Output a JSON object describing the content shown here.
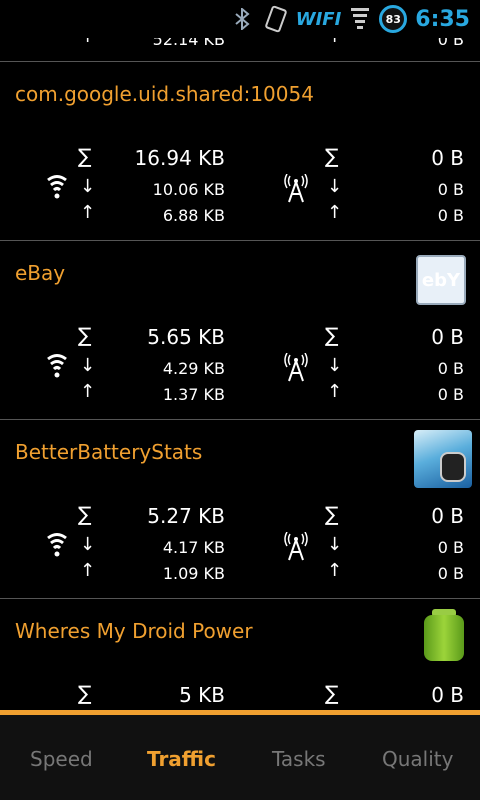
{
  "status_bar": {
    "time": "6:35",
    "battery_level": "83",
    "wifi_label": "WIFI"
  },
  "partial_top": {
    "total": "52.14 KB",
    "mobile_total": "0 B"
  },
  "apps": [
    {
      "name": "com.google.uid.shared:10054",
      "wifi_total": "16.94 KB",
      "wifi_down": "10.06 KB",
      "wifi_up": "6.88 KB",
      "mobile_total": "0 B",
      "mobile_down": "0 B",
      "mobile_up": "0 B",
      "icon": "none"
    },
    {
      "name": "eBay",
      "wifi_total": "5.65 KB",
      "wifi_down": "4.29 KB",
      "wifi_up": "1.37 KB",
      "mobile_total": "0 B",
      "mobile_down": "0 B",
      "mobile_up": "0 B",
      "icon": "ebay-icon",
      "icon_text": "ebY"
    },
    {
      "name": "BetterBatteryStats",
      "wifi_total": "5.27 KB",
      "wifi_down": "4.17 KB",
      "wifi_up": "1.09 KB",
      "mobile_total": "0 B",
      "mobile_down": "0 B",
      "mobile_up": "0 B",
      "icon": "betterbatterystats-icon"
    },
    {
      "name": "Wheres My Droid Power",
      "wifi_total": "5 KB",
      "mobile_total": "0 B",
      "icon": "battery-icon"
    }
  ],
  "symbols": {
    "sum": "∑",
    "down": "↓",
    "up": "↑"
  },
  "tabs": [
    {
      "label": "Speed",
      "active": false
    },
    {
      "label": "Traffic",
      "active": true
    },
    {
      "label": "Tasks",
      "active": false
    },
    {
      "label": "Quality",
      "active": false
    }
  ],
  "colors": {
    "accent": "#f0a030",
    "clock": "#29a8e0",
    "inactive_tab": "#777777"
  }
}
